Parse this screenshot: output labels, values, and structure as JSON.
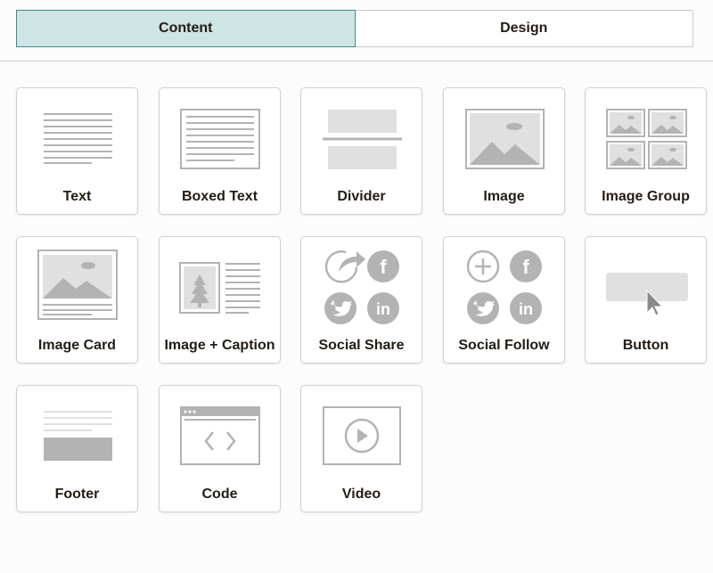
{
  "tabs": [
    {
      "label": "Content",
      "active": true
    },
    {
      "label": "Design",
      "active": false
    }
  ],
  "blocks": [
    {
      "label": "Text",
      "icon": "text-lines-icon"
    },
    {
      "label": "Boxed Text",
      "icon": "boxed-text-icon"
    },
    {
      "label": "Divider",
      "icon": "divider-icon"
    },
    {
      "label": "Image",
      "icon": "image-icon"
    },
    {
      "label": "Image Group",
      "icon": "image-group-icon"
    },
    {
      "label": "Image Card",
      "icon": "image-card-icon"
    },
    {
      "label": "Image + Caption",
      "icon": "image-caption-icon"
    },
    {
      "label": "Social Share",
      "icon": "social-share-icon"
    },
    {
      "label": "Social Follow",
      "icon": "social-follow-icon"
    },
    {
      "label": "Button",
      "icon": "button-icon"
    },
    {
      "label": "Footer",
      "icon": "footer-icon"
    },
    {
      "label": "Code",
      "icon": "code-icon"
    },
    {
      "label": "Video",
      "icon": "video-icon"
    }
  ],
  "colors": {
    "active_tab_bg": "#cfe5e5",
    "active_tab_border": "#3a8c8c",
    "icon_gray": "#b3b3b3",
    "icon_light": "#e0e0e0"
  }
}
